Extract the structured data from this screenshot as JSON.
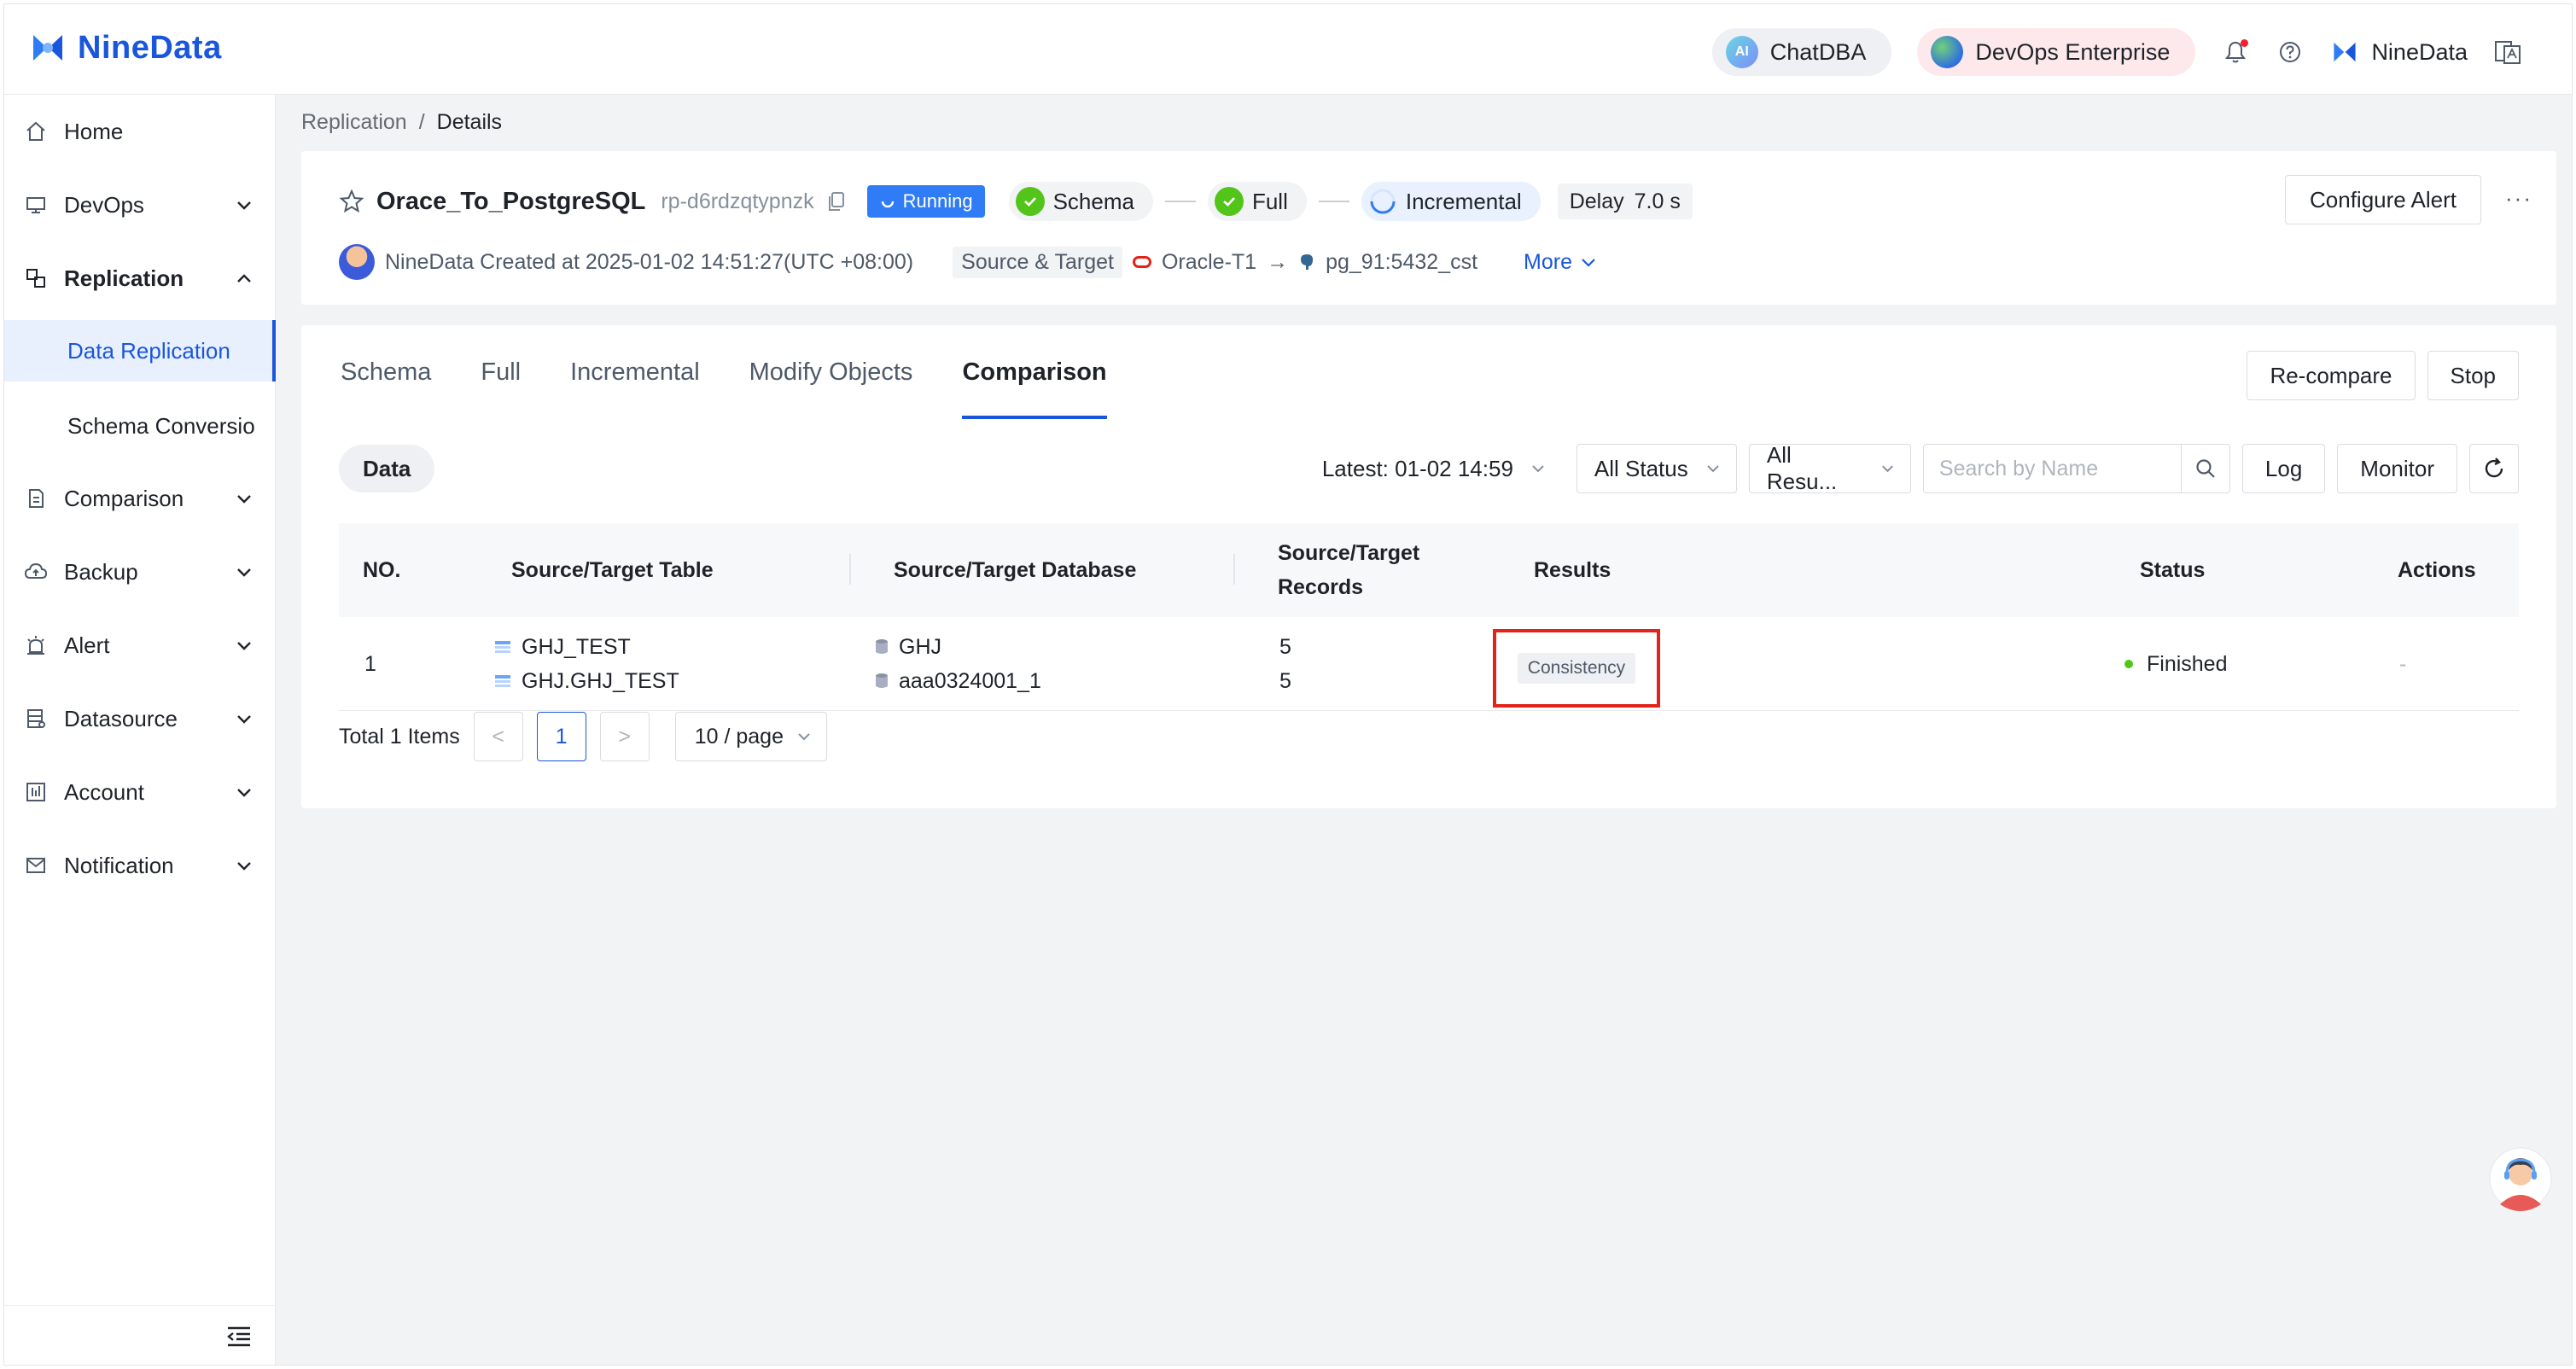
{
  "header": {
    "brand": "NineData",
    "chatdba_label": "ChatDBA",
    "chatdba_icon_text": "AI",
    "devops_label": "DevOps Enterprise",
    "user_name": "NineData",
    "icons": [
      "bell-icon",
      "help-icon",
      "language-icon"
    ]
  },
  "sidebar": {
    "home": "Home",
    "devops": "DevOps",
    "replication": "Replication",
    "data_replication": "Data Replication",
    "schema_conversion": "Schema Conversio",
    "comparison": "Comparison",
    "backup": "Backup",
    "alert": "Alert",
    "datasource": "Datasource",
    "account": "Account",
    "notification": "Notification"
  },
  "breadcrumb": {
    "parent": "Replication",
    "separator": "/",
    "current": "Details"
  },
  "task": {
    "name": "Orace_To_PostgreSQL",
    "id": "rp-d6rdzqtypnzk",
    "status": "Running",
    "stages": {
      "schema": "Schema",
      "full": "Full",
      "incremental": "Incremental"
    },
    "delay_label": "Delay",
    "delay_value": "7.0 s",
    "creator_line": "NineData Created at 2025-01-02 14:51:27(UTC +08:00)",
    "source_target_label": "Source & Target",
    "source": "Oracle-T1",
    "arrow": "→",
    "target": "pg_91:5432_cst",
    "more": "More",
    "configure_alert": "Configure Alert",
    "more_dots": "···"
  },
  "tabs": {
    "schema": "Schema",
    "full": "Full",
    "incremental": "Incremental",
    "modify_objects": "Modify Objects",
    "comparison": "Comparison",
    "recompare": "Re-compare",
    "stop": "Stop"
  },
  "filters": {
    "data_chip": "Data",
    "latest": "Latest: 01-02 14:59",
    "status": "All Status",
    "results": "All Resu...",
    "search_placeholder": "Search by Name",
    "log": "Log",
    "monitor": "Monitor"
  },
  "table": {
    "headers": {
      "no": "NO.",
      "table": "Source/Target Table",
      "database": "Source/Target Database",
      "records_l1": "Source/Target",
      "records_l2": "Records",
      "results": "Results",
      "status": "Status",
      "actions": "Actions"
    },
    "rows": [
      {
        "no": "1",
        "source_table": "GHJ_TEST",
        "target_table": "GHJ.GHJ_TEST",
        "source_db": "GHJ",
        "target_db": "aaa0324001_1",
        "source_records": "5",
        "target_records": "5",
        "result": "Consistency",
        "status": "Finished",
        "action": "-"
      }
    ]
  },
  "pagination": {
    "total": "Total 1 Items",
    "prev": "<",
    "page": "1",
    "next": ">",
    "page_size": "10 / page"
  },
  "colors": {
    "accent": "#1a56db",
    "running": "#2f7cf6",
    "success": "#52c41a",
    "highlight_box": "#e2231a"
  }
}
